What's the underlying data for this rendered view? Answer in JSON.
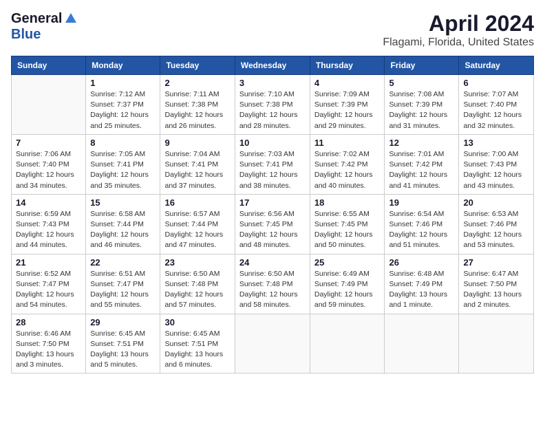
{
  "header": {
    "logo_general": "General",
    "logo_blue": "Blue",
    "month_title": "April 2024",
    "location": "Flagami, Florida, United States"
  },
  "weekdays": [
    "Sunday",
    "Monday",
    "Tuesday",
    "Wednesday",
    "Thursday",
    "Friday",
    "Saturday"
  ],
  "weeks": [
    [
      {
        "day": "",
        "info": ""
      },
      {
        "day": "1",
        "info": "Sunrise: 7:12 AM\nSunset: 7:37 PM\nDaylight: 12 hours\nand 25 minutes."
      },
      {
        "day": "2",
        "info": "Sunrise: 7:11 AM\nSunset: 7:38 PM\nDaylight: 12 hours\nand 26 minutes."
      },
      {
        "day": "3",
        "info": "Sunrise: 7:10 AM\nSunset: 7:38 PM\nDaylight: 12 hours\nand 28 minutes."
      },
      {
        "day": "4",
        "info": "Sunrise: 7:09 AM\nSunset: 7:39 PM\nDaylight: 12 hours\nand 29 minutes."
      },
      {
        "day": "5",
        "info": "Sunrise: 7:08 AM\nSunset: 7:39 PM\nDaylight: 12 hours\nand 31 minutes."
      },
      {
        "day": "6",
        "info": "Sunrise: 7:07 AM\nSunset: 7:40 PM\nDaylight: 12 hours\nand 32 minutes."
      }
    ],
    [
      {
        "day": "7",
        "info": "Sunrise: 7:06 AM\nSunset: 7:40 PM\nDaylight: 12 hours\nand 34 minutes."
      },
      {
        "day": "8",
        "info": "Sunrise: 7:05 AM\nSunset: 7:41 PM\nDaylight: 12 hours\nand 35 minutes."
      },
      {
        "day": "9",
        "info": "Sunrise: 7:04 AM\nSunset: 7:41 PM\nDaylight: 12 hours\nand 37 minutes."
      },
      {
        "day": "10",
        "info": "Sunrise: 7:03 AM\nSunset: 7:41 PM\nDaylight: 12 hours\nand 38 minutes."
      },
      {
        "day": "11",
        "info": "Sunrise: 7:02 AM\nSunset: 7:42 PM\nDaylight: 12 hours\nand 40 minutes."
      },
      {
        "day": "12",
        "info": "Sunrise: 7:01 AM\nSunset: 7:42 PM\nDaylight: 12 hours\nand 41 minutes."
      },
      {
        "day": "13",
        "info": "Sunrise: 7:00 AM\nSunset: 7:43 PM\nDaylight: 12 hours\nand 43 minutes."
      }
    ],
    [
      {
        "day": "14",
        "info": "Sunrise: 6:59 AM\nSunset: 7:43 PM\nDaylight: 12 hours\nand 44 minutes."
      },
      {
        "day": "15",
        "info": "Sunrise: 6:58 AM\nSunset: 7:44 PM\nDaylight: 12 hours\nand 46 minutes."
      },
      {
        "day": "16",
        "info": "Sunrise: 6:57 AM\nSunset: 7:44 PM\nDaylight: 12 hours\nand 47 minutes."
      },
      {
        "day": "17",
        "info": "Sunrise: 6:56 AM\nSunset: 7:45 PM\nDaylight: 12 hours\nand 48 minutes."
      },
      {
        "day": "18",
        "info": "Sunrise: 6:55 AM\nSunset: 7:45 PM\nDaylight: 12 hours\nand 50 minutes."
      },
      {
        "day": "19",
        "info": "Sunrise: 6:54 AM\nSunset: 7:46 PM\nDaylight: 12 hours\nand 51 minutes."
      },
      {
        "day": "20",
        "info": "Sunrise: 6:53 AM\nSunset: 7:46 PM\nDaylight: 12 hours\nand 53 minutes."
      }
    ],
    [
      {
        "day": "21",
        "info": "Sunrise: 6:52 AM\nSunset: 7:47 PM\nDaylight: 12 hours\nand 54 minutes."
      },
      {
        "day": "22",
        "info": "Sunrise: 6:51 AM\nSunset: 7:47 PM\nDaylight: 12 hours\nand 55 minutes."
      },
      {
        "day": "23",
        "info": "Sunrise: 6:50 AM\nSunset: 7:48 PM\nDaylight: 12 hours\nand 57 minutes."
      },
      {
        "day": "24",
        "info": "Sunrise: 6:50 AM\nSunset: 7:48 PM\nDaylight: 12 hours\nand 58 minutes."
      },
      {
        "day": "25",
        "info": "Sunrise: 6:49 AM\nSunset: 7:49 PM\nDaylight: 12 hours\nand 59 minutes."
      },
      {
        "day": "26",
        "info": "Sunrise: 6:48 AM\nSunset: 7:49 PM\nDaylight: 13 hours\nand 1 minute."
      },
      {
        "day": "27",
        "info": "Sunrise: 6:47 AM\nSunset: 7:50 PM\nDaylight: 13 hours\nand 2 minutes."
      }
    ],
    [
      {
        "day": "28",
        "info": "Sunrise: 6:46 AM\nSunset: 7:50 PM\nDaylight: 13 hours\nand 3 minutes."
      },
      {
        "day": "29",
        "info": "Sunrise: 6:45 AM\nSunset: 7:51 PM\nDaylight: 13 hours\nand 5 minutes."
      },
      {
        "day": "30",
        "info": "Sunrise: 6:45 AM\nSunset: 7:51 PM\nDaylight: 13 hours\nand 6 minutes."
      },
      {
        "day": "",
        "info": ""
      },
      {
        "day": "",
        "info": ""
      },
      {
        "day": "",
        "info": ""
      },
      {
        "day": "",
        "info": ""
      }
    ]
  ]
}
